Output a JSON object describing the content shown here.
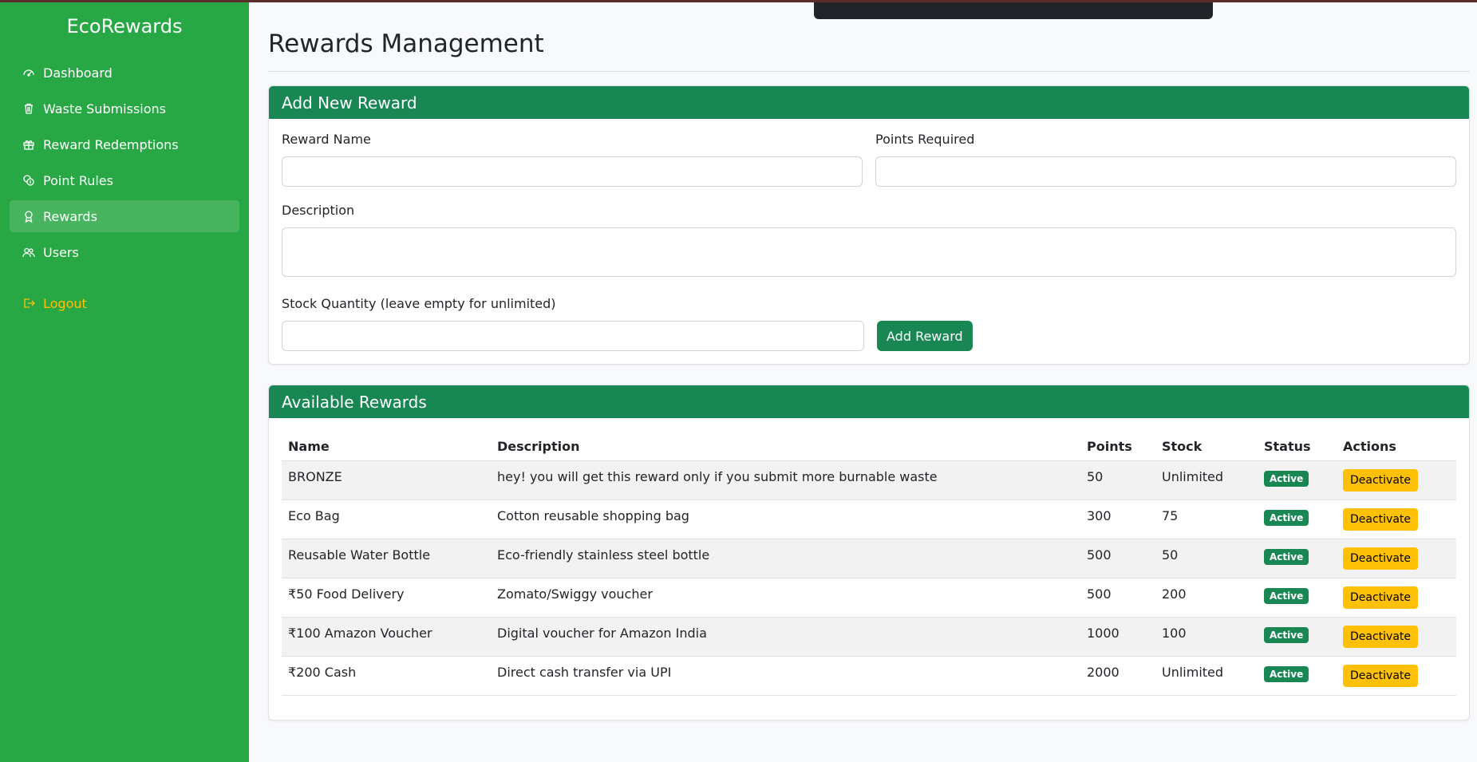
{
  "sidebar": {
    "brand": "EcoRewards",
    "items": [
      {
        "label": "Dashboard"
      },
      {
        "label": "Waste Submissions"
      },
      {
        "label": "Reward Redemptions"
      },
      {
        "label": "Point Rules"
      },
      {
        "label": "Rewards"
      },
      {
        "label": "Users"
      }
    ],
    "logout": "Logout",
    "active_item": "Rewards"
  },
  "page": {
    "title": "Rewards Management"
  },
  "add_reward": {
    "header": "Add New Reward",
    "name_label": "Reward Name",
    "name_value": "",
    "points_label": "Points Required",
    "points_value": "",
    "description_label": "Description",
    "description_value": "",
    "stock_label": "Stock Quantity (leave empty for unlimited)",
    "stock_value": "",
    "submit_label": "Add Reward"
  },
  "rewards_table": {
    "header": "Available Rewards",
    "columns": [
      "Name",
      "Description",
      "Points",
      "Stock",
      "Status",
      "Actions"
    ],
    "rows": [
      {
        "name": "BRONZE",
        "description": "hey! you will get this reward only if you submit more burnable waste",
        "points": "50",
        "stock": "Unlimited",
        "status": "Active",
        "action": "Deactivate"
      },
      {
        "name": "Eco Bag",
        "description": "Cotton reusable shopping bag",
        "points": "300",
        "stock": "75",
        "status": "Active",
        "action": "Deactivate"
      },
      {
        "name": "Reusable Water Bottle",
        "description": "Eco-friendly stainless steel bottle",
        "points": "500",
        "stock": "50",
        "status": "Active",
        "action": "Deactivate"
      },
      {
        "name": "₹50 Food Delivery",
        "description": "Zomato/Swiggy voucher",
        "points": "500",
        "stock": "200",
        "status": "Active",
        "action": "Deactivate"
      },
      {
        "name": "₹100 Amazon Voucher",
        "description": "Digital voucher for Amazon India",
        "points": "1000",
        "stock": "100",
        "status": "Active",
        "action": "Deactivate"
      },
      {
        "name": "₹200 Cash",
        "description": "Direct cash transfer via UPI",
        "points": "2000",
        "stock": "Unlimited",
        "status": "Active",
        "action": "Deactivate"
      }
    ]
  },
  "colors": {
    "sidebar_bg": "#28a745",
    "header_green": "#198754",
    "warning": "#ffc107"
  }
}
